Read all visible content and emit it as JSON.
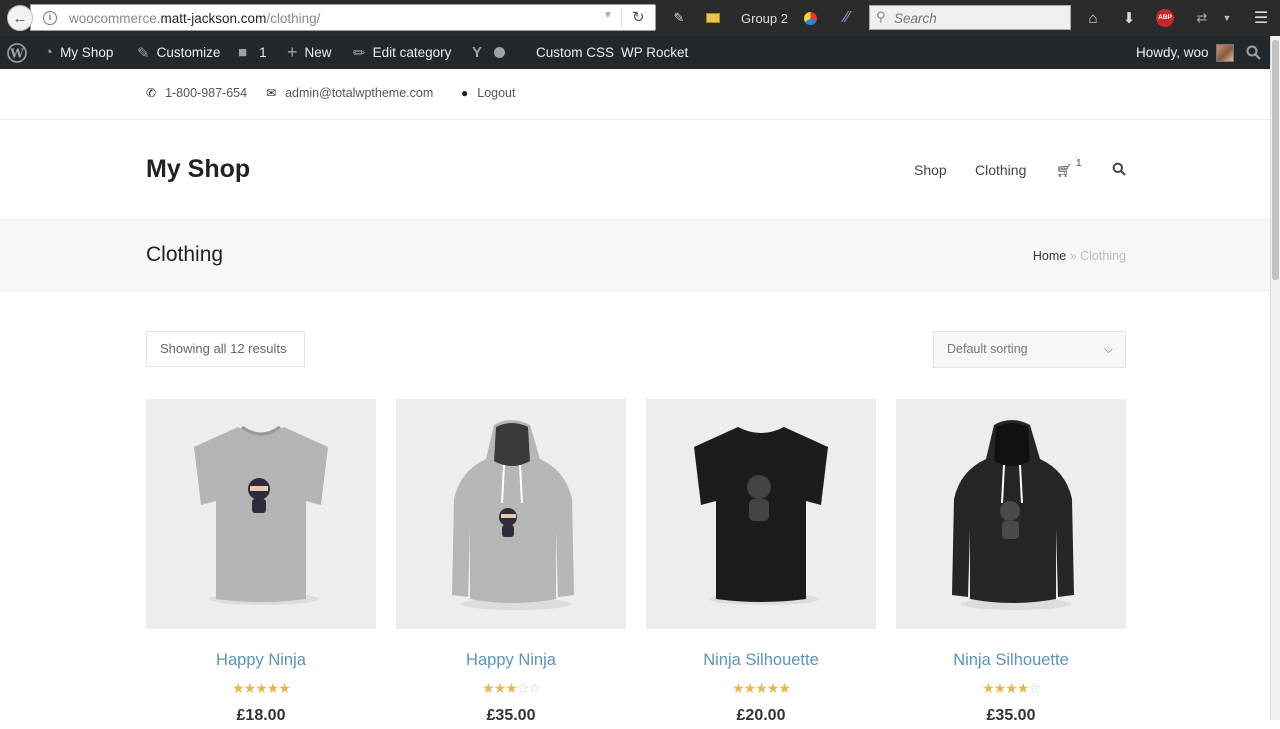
{
  "browser": {
    "url_prefix": "woocommerce.",
    "url_domain": "matt-jackson.com",
    "url_path": "/clothing/",
    "group_label": "Group 2",
    "search_placeholder": "Search"
  },
  "adminbar": {
    "site_name": "My Shop",
    "customize": "Customize",
    "comments_count": "1",
    "new": "New",
    "edit_category": "Edit category",
    "custom_css": "Custom CSS",
    "wp_rocket": "WP Rocket",
    "howdy": "Howdy, woo"
  },
  "topbar": {
    "phone": "1-800-987-654",
    "email": "admin@totalwptheme.com",
    "logout": "Logout"
  },
  "header": {
    "logo": "My Shop",
    "nav": [
      "Shop",
      "Clothing"
    ],
    "cart_count": "1"
  },
  "page": {
    "title": "Clothing",
    "breadcrumb_home": "Home",
    "breadcrumb_sep": " » ",
    "breadcrumb_current": "Clothing"
  },
  "toolbar": {
    "result_count": "Showing all 12 results",
    "sorting": "Default sorting"
  },
  "products": [
    {
      "name": "Happy Ninja",
      "rating": 5,
      "price": "£18.00",
      "image": "tshirt-grey"
    },
    {
      "name": "Happy Ninja",
      "rating": 3,
      "price": "£35.00",
      "image": "hoodie-grey"
    },
    {
      "name": "Ninja Silhouette",
      "rating": 5,
      "price": "£20.00",
      "image": "tshirt-black"
    },
    {
      "name": "Ninja Silhouette",
      "rating": 4,
      "price": "£35.00",
      "image": "hoodie-black"
    }
  ],
  "colors": {
    "adminbar_bg": "#23282d",
    "link_blue": "#5a93bd",
    "star_gold": "#e6b84a",
    "page_header_bg": "#f7f7f7"
  }
}
